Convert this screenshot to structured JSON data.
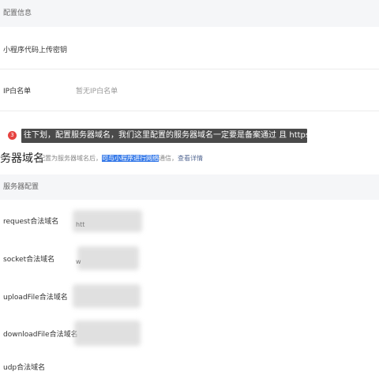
{
  "config_section": {
    "header": "配置信息",
    "rows": [
      {
        "label": "小程序代码上传密钥",
        "value": ""
      },
      {
        "label": "IP白名单",
        "value": "暂无IP白名单"
      }
    ]
  },
  "tooltip": {
    "step": "3",
    "text": "往下划，配置服务器域名，我们这里配置的服务器域名一定要是备案通过 且 https://开头"
  },
  "server_domain": {
    "title": "务器域名",
    "desc_before": "配置为服务器域名后，",
    "desc_highlight": "可与小程序进行网络",
    "desc_after": "通信，",
    "detail_link": "查看详情"
  },
  "server_config": {
    "header": "服务器配置",
    "rows": [
      {
        "label": "request合法域名",
        "partial": "htt"
      },
      {
        "label": "socket合法域名",
        "partial": "w"
      },
      {
        "label": "uploadFile合法域名",
        "partial": ""
      },
      {
        "label": "downloadFile合法域名",
        "partial": ""
      },
      {
        "label": "udp合法域名",
        "partial": ""
      }
    ]
  }
}
